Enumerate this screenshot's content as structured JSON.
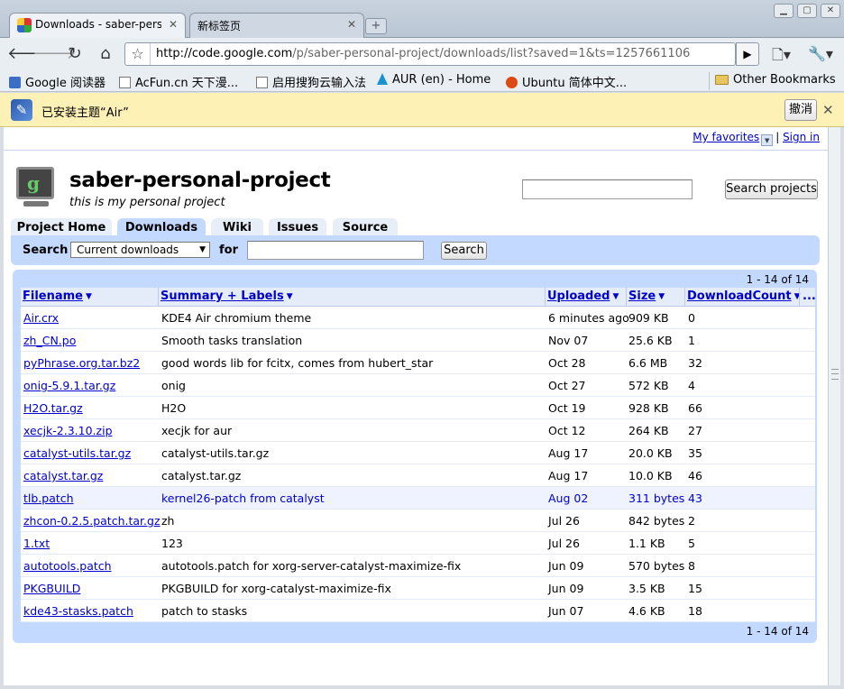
{
  "browser": {
    "tabs": [
      {
        "title": "Downloads - saber-perso···"
      },
      {
        "title": "新标签页"
      }
    ],
    "url_host": "http://code.google.com",
    "url_path": "/p/saber-personal-project/downloads/list?saved=1&ts=1257661106",
    "bookmarks": [
      {
        "label": "Google 阅读器",
        "icon": "rss-icon"
      },
      {
        "label": "AcFun.cn 天下漫...",
        "icon": "page-icon"
      },
      {
        "label": "启用搜狗云输入法",
        "icon": "page-icon"
      },
      {
        "label": "AUR (en) - Home",
        "icon": "arch-icon"
      },
      {
        "label": "Ubuntu 简体中文...",
        "icon": "ubuntu-icon"
      }
    ],
    "other_bookmarks": "Other Bookmarks",
    "infobar": {
      "message": "已安装主题“Air”",
      "undo": "撤消"
    }
  },
  "page": {
    "my_favorites": "My favorites",
    "separator": "|",
    "sign_in": "Sign in",
    "project_name": "saber-personal-project",
    "project_summary": "this is my personal project",
    "search_projects": "Search projects",
    "tabs": [
      "Project Home",
      "Downloads",
      "Wiki",
      "Issues",
      "Source"
    ],
    "search_label": "Search",
    "scope": "Current downloads",
    "for_label": "for",
    "search_button": "Search",
    "pagination": "1 - 14 of 14",
    "columns": {
      "filename": "Filename",
      "summary": "Summary + Labels",
      "uploaded": "Uploaded",
      "size": "Size",
      "downloads": "DownloadCount",
      "more": "..."
    },
    "rows": [
      {
        "file": "Air.crx",
        "summary": "KDE4 Air chromium theme",
        "uploaded": "6 minutes ago",
        "size": "909 KB",
        "count": "0"
      },
      {
        "file": "zh_CN.po",
        "summary": "Smooth tasks translation",
        "uploaded": "Nov 07",
        "size": "25.6 KB",
        "count": "1"
      },
      {
        "file": "pyPhrase.org.tar.bz2",
        "summary": "good words lib for fcitx, comes from hubert_star",
        "uploaded": "Oct 28",
        "size": "6.6 MB",
        "count": "32"
      },
      {
        "file": "onig-5.9.1.tar.gz",
        "summary": "onig",
        "uploaded": "Oct 27",
        "size": "572 KB",
        "count": "4"
      },
      {
        "file": "H2O.tar.gz",
        "summary": "H2O",
        "uploaded": "Oct 19",
        "size": "928 KB",
        "count": "66"
      },
      {
        "file": "xecjk-2.3.10.zip",
        "summary": "xecjk for aur",
        "uploaded": "Oct 12",
        "size": "264 KB",
        "count": "27"
      },
      {
        "file": "catalyst-utils.tar.gz",
        "summary": "catalyst-utils.tar.gz",
        "uploaded": "Aug 17",
        "size": "20.0 KB",
        "count": "35"
      },
      {
        "file": "catalyst.tar.gz",
        "summary": "catalyst.tar.gz",
        "uploaded": "Aug 17",
        "size": "10.0 KB",
        "count": "46"
      },
      {
        "file": "tlb.patch",
        "summary": "kernel26-patch from catalyst",
        "uploaded": "Aug 02",
        "size": "311 bytes",
        "count": "43"
      },
      {
        "file": "zhcon-0.2.5.patch.tar.gz",
        "summary": "zh",
        "uploaded": "Jul 26",
        "size": "842 bytes",
        "count": "2"
      },
      {
        "file": "1.txt",
        "summary": "123",
        "uploaded": "Jul 26",
        "size": "1.1 KB",
        "count": "5"
      },
      {
        "file": "autotools.patch",
        "summary": "autotools.patch for xorg-server-catalyst-maximize-fix",
        "uploaded": "Jun 09",
        "size": "570 bytes",
        "count": "8"
      },
      {
        "file": "PKGBUILD",
        "summary": "PKGBUILD for xorg-catalyst-maximize-fix",
        "uploaded": "Jun 09",
        "size": "3.5 KB",
        "count": "15"
      },
      {
        "file": "kde43-stasks.patch",
        "summary": "patch to stasks",
        "uploaded": "Jun 07",
        "size": "4.6 KB",
        "count": "18"
      }
    ]
  }
}
